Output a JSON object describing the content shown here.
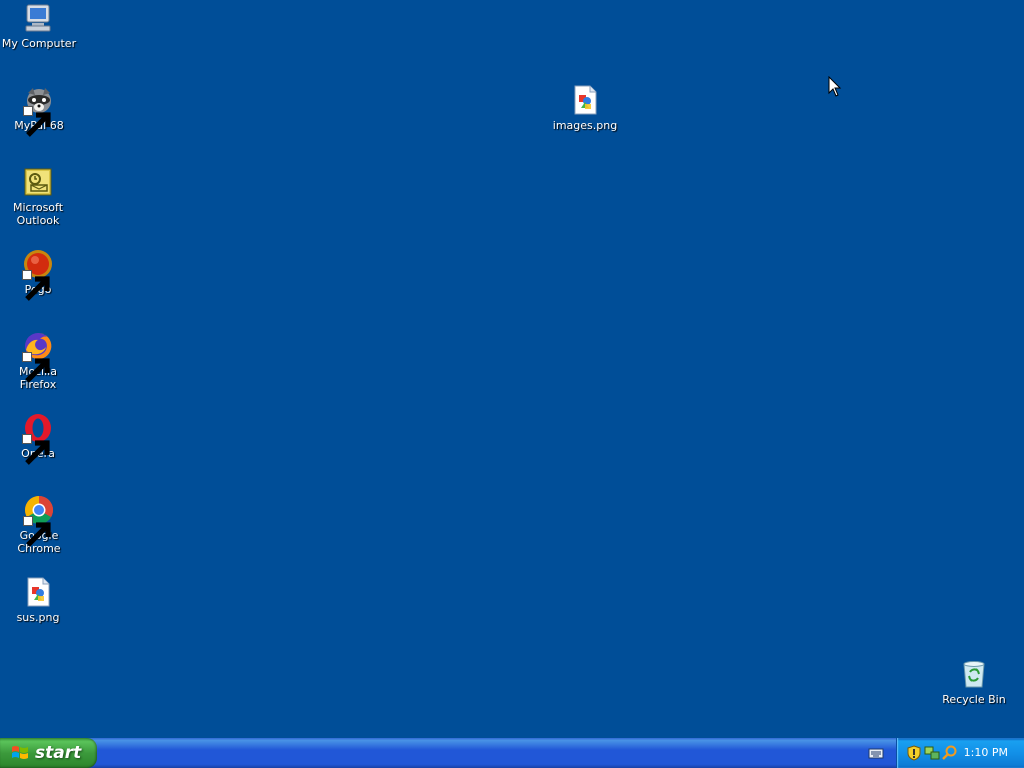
{
  "desktop": {
    "background_color": "#004e98",
    "icons": [
      {
        "name": "my-computer",
        "label": "My Computer",
        "icon": "computer-icon",
        "shortcut": false
      },
      {
        "name": "mypal-68",
        "label": "MyPal 68",
        "icon": "mypal-raccoon-icon",
        "shortcut": true
      },
      {
        "name": "microsoft-outlook",
        "label": "Microsoft\nOutlook",
        "icon": "outlook-icon",
        "shortcut": false
      },
      {
        "name": "pego",
        "label": "Pego",
        "icon": "pego-icon",
        "shortcut": true
      },
      {
        "name": "mozilla-firefox",
        "label": "Mozilla Firefox",
        "icon": "firefox-icon",
        "shortcut": true
      },
      {
        "name": "opera",
        "label": "Opera",
        "icon": "opera-icon",
        "shortcut": true
      },
      {
        "name": "google-chrome",
        "label": "Google Chrome",
        "icon": "chrome-icon",
        "shortcut": true
      },
      {
        "name": "sus-png",
        "label": "sus.png",
        "icon": "image-file-icon",
        "shortcut": false
      },
      {
        "name": "images-png",
        "label": "images.png",
        "icon": "image-file-icon",
        "shortcut": false
      },
      {
        "name": "recycle-bin",
        "label": "Recycle Bin",
        "icon": "recycle-bin-icon",
        "shortcut": false
      }
    ]
  },
  "taskbar": {
    "start_label": "start",
    "clock": "1:10 PM",
    "tray_icons": [
      "keyboard-icon",
      "security-shield-icon",
      "network-icon",
      "search-icon"
    ]
  },
  "colors": {
    "desktop": "#004e98",
    "taskbar": "#2157d7",
    "start_button": "#3c9a3c",
    "tray": "#1290e8"
  }
}
